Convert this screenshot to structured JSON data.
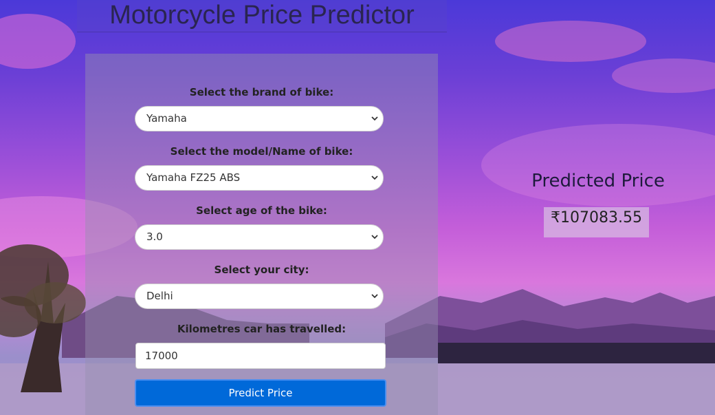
{
  "header": {
    "title": "Motorcycle Price Predictor"
  },
  "form": {
    "brand": {
      "label": "Select the brand of bike:",
      "value": "Yamaha"
    },
    "model": {
      "label": "Select the model/Name of bike:",
      "value": "Yamaha FZ25 ABS"
    },
    "age": {
      "label": "Select age of the bike:",
      "value": "3.0"
    },
    "city": {
      "label": "Select your city:",
      "value": "Delhi"
    },
    "kms": {
      "label": "Kilometres car has travelled:",
      "value": "17000"
    },
    "submit_label": "Predict Price"
  },
  "result": {
    "heading": "Predicted Price",
    "value": "₹107083.55"
  },
  "icons": {
    "select_chevron": "chevron-down-icon"
  },
  "colors": {
    "button": "#0069d9",
    "title_text": "#2a2550"
  }
}
